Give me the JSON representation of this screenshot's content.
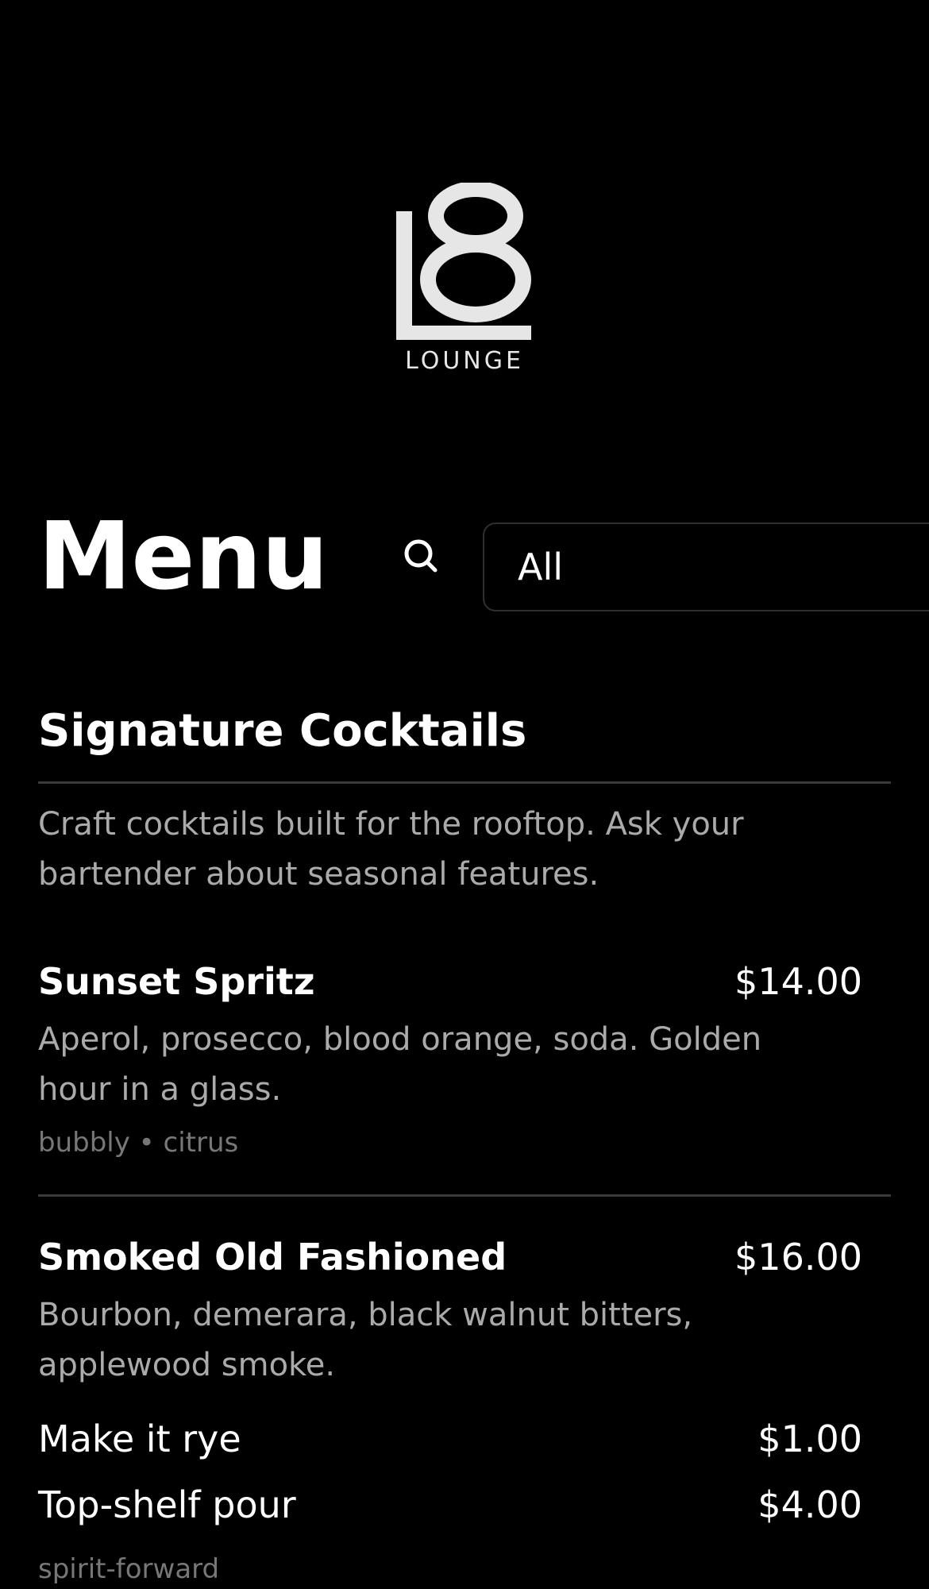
{
  "brand": {
    "logo_mark": "L8",
    "logo_word": "LOUNGE",
    "logo_color": "#e6e6e6"
  },
  "header": {
    "title": "Menu",
    "search_icon": "search-icon",
    "filter": {
      "selected": "All",
      "chevron_icon": "chevron-down-icon"
    }
  },
  "sections": [
    {
      "title": "Signature Cocktails",
      "description": "Craft cocktails built for the rooftop. Ask your bartender about seasonal features.",
      "items": [
        {
          "name": "Sunset Spritz",
          "price": "$14.00",
          "description": "Aperol, prosecco, blood orange, soda. Golden hour in a glass.",
          "tags": "bubbly • citrus"
        },
        {
          "name": "Smoked Old Fashioned",
          "price": "$16.00",
          "description": "Bourbon, demerara, black walnut bitters, applewood smoke.",
          "options": [
            {
              "name": "Make it rye",
              "price": "$1.00"
            },
            {
              "name": "Top-shelf pour",
              "price": "$4.00"
            }
          ],
          "tags": "spirit-forward"
        }
      ]
    }
  ],
  "colors": {
    "background": "#000000",
    "text": "#ffffff",
    "muted_text": "#aaaaaa",
    "tag_text": "#777777",
    "divider": "#3a3a3a"
  }
}
